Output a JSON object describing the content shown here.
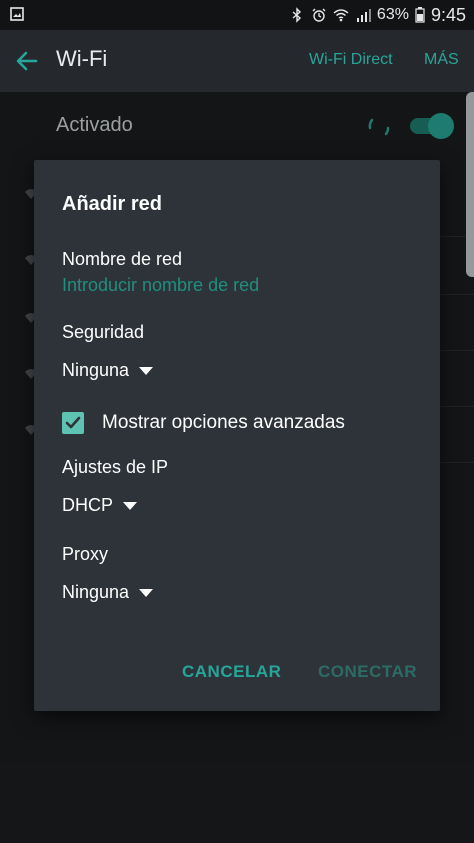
{
  "statusbar": {
    "battery": "63%",
    "time": "9:45",
    "icons": [
      "image-icon",
      "bluetooth-icon",
      "alarm-icon",
      "wifi-icon",
      "signal-icon",
      "battery-icon"
    ]
  },
  "appbar": {
    "title": "Wi-Fi",
    "wifi_direct": "Wi-Fi Direct",
    "more": "MÁS"
  },
  "background": {
    "activated_label": "Activado",
    "toggle_on": true
  },
  "dialog": {
    "title": "Añadir red",
    "network_name_label": "Nombre de red",
    "network_name_placeholder": "Introducir nombre de red",
    "security_label": "Seguridad",
    "security_value": "Ninguna",
    "advanced_label": "Mostrar opciones avanzadas",
    "advanced_checked": true,
    "ip_label": "Ajustes de IP",
    "ip_value": "DHCP",
    "proxy_label": "Proxy",
    "proxy_value": "Ninguna",
    "cancel": "CANCELAR",
    "connect": "CONECTAR"
  },
  "colors": {
    "accent": "#26a69a",
    "dialog_bg": "#2d3338",
    "appbar_bg": "#25292d"
  }
}
